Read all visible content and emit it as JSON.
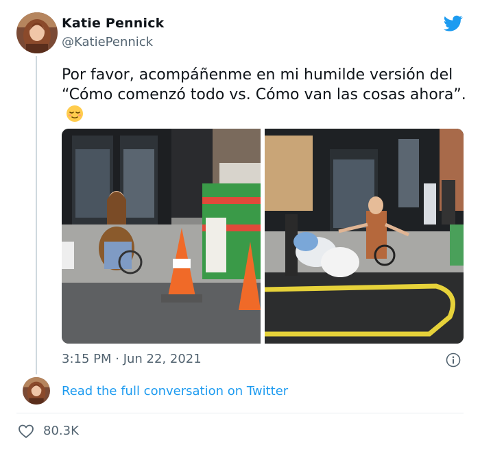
{
  "tweet": {
    "author": {
      "display_name": "Katie Pennick",
      "handle": "@KatiePennick"
    },
    "text": "Por favor, acompáñenme en mi humilde versión del “Cómo comenzó todo vs. Cómo van las cosas ahora”.",
    "emoji_icon": "relieved-face-icon",
    "timestamp": "3:15 PM · Jun 22, 2021",
    "read_conversation_label": "Read the full conversation on Twitter",
    "likes": "80.3K"
  },
  "icons": {
    "brand": "twitter-bird-icon",
    "info": "info-icon",
    "like": "heart-icon"
  },
  "colors": {
    "brand_blue": "#1d9bf0",
    "text_primary": "#0f1419",
    "text_secondary": "#536471",
    "divider": "#e6ecf0"
  }
}
